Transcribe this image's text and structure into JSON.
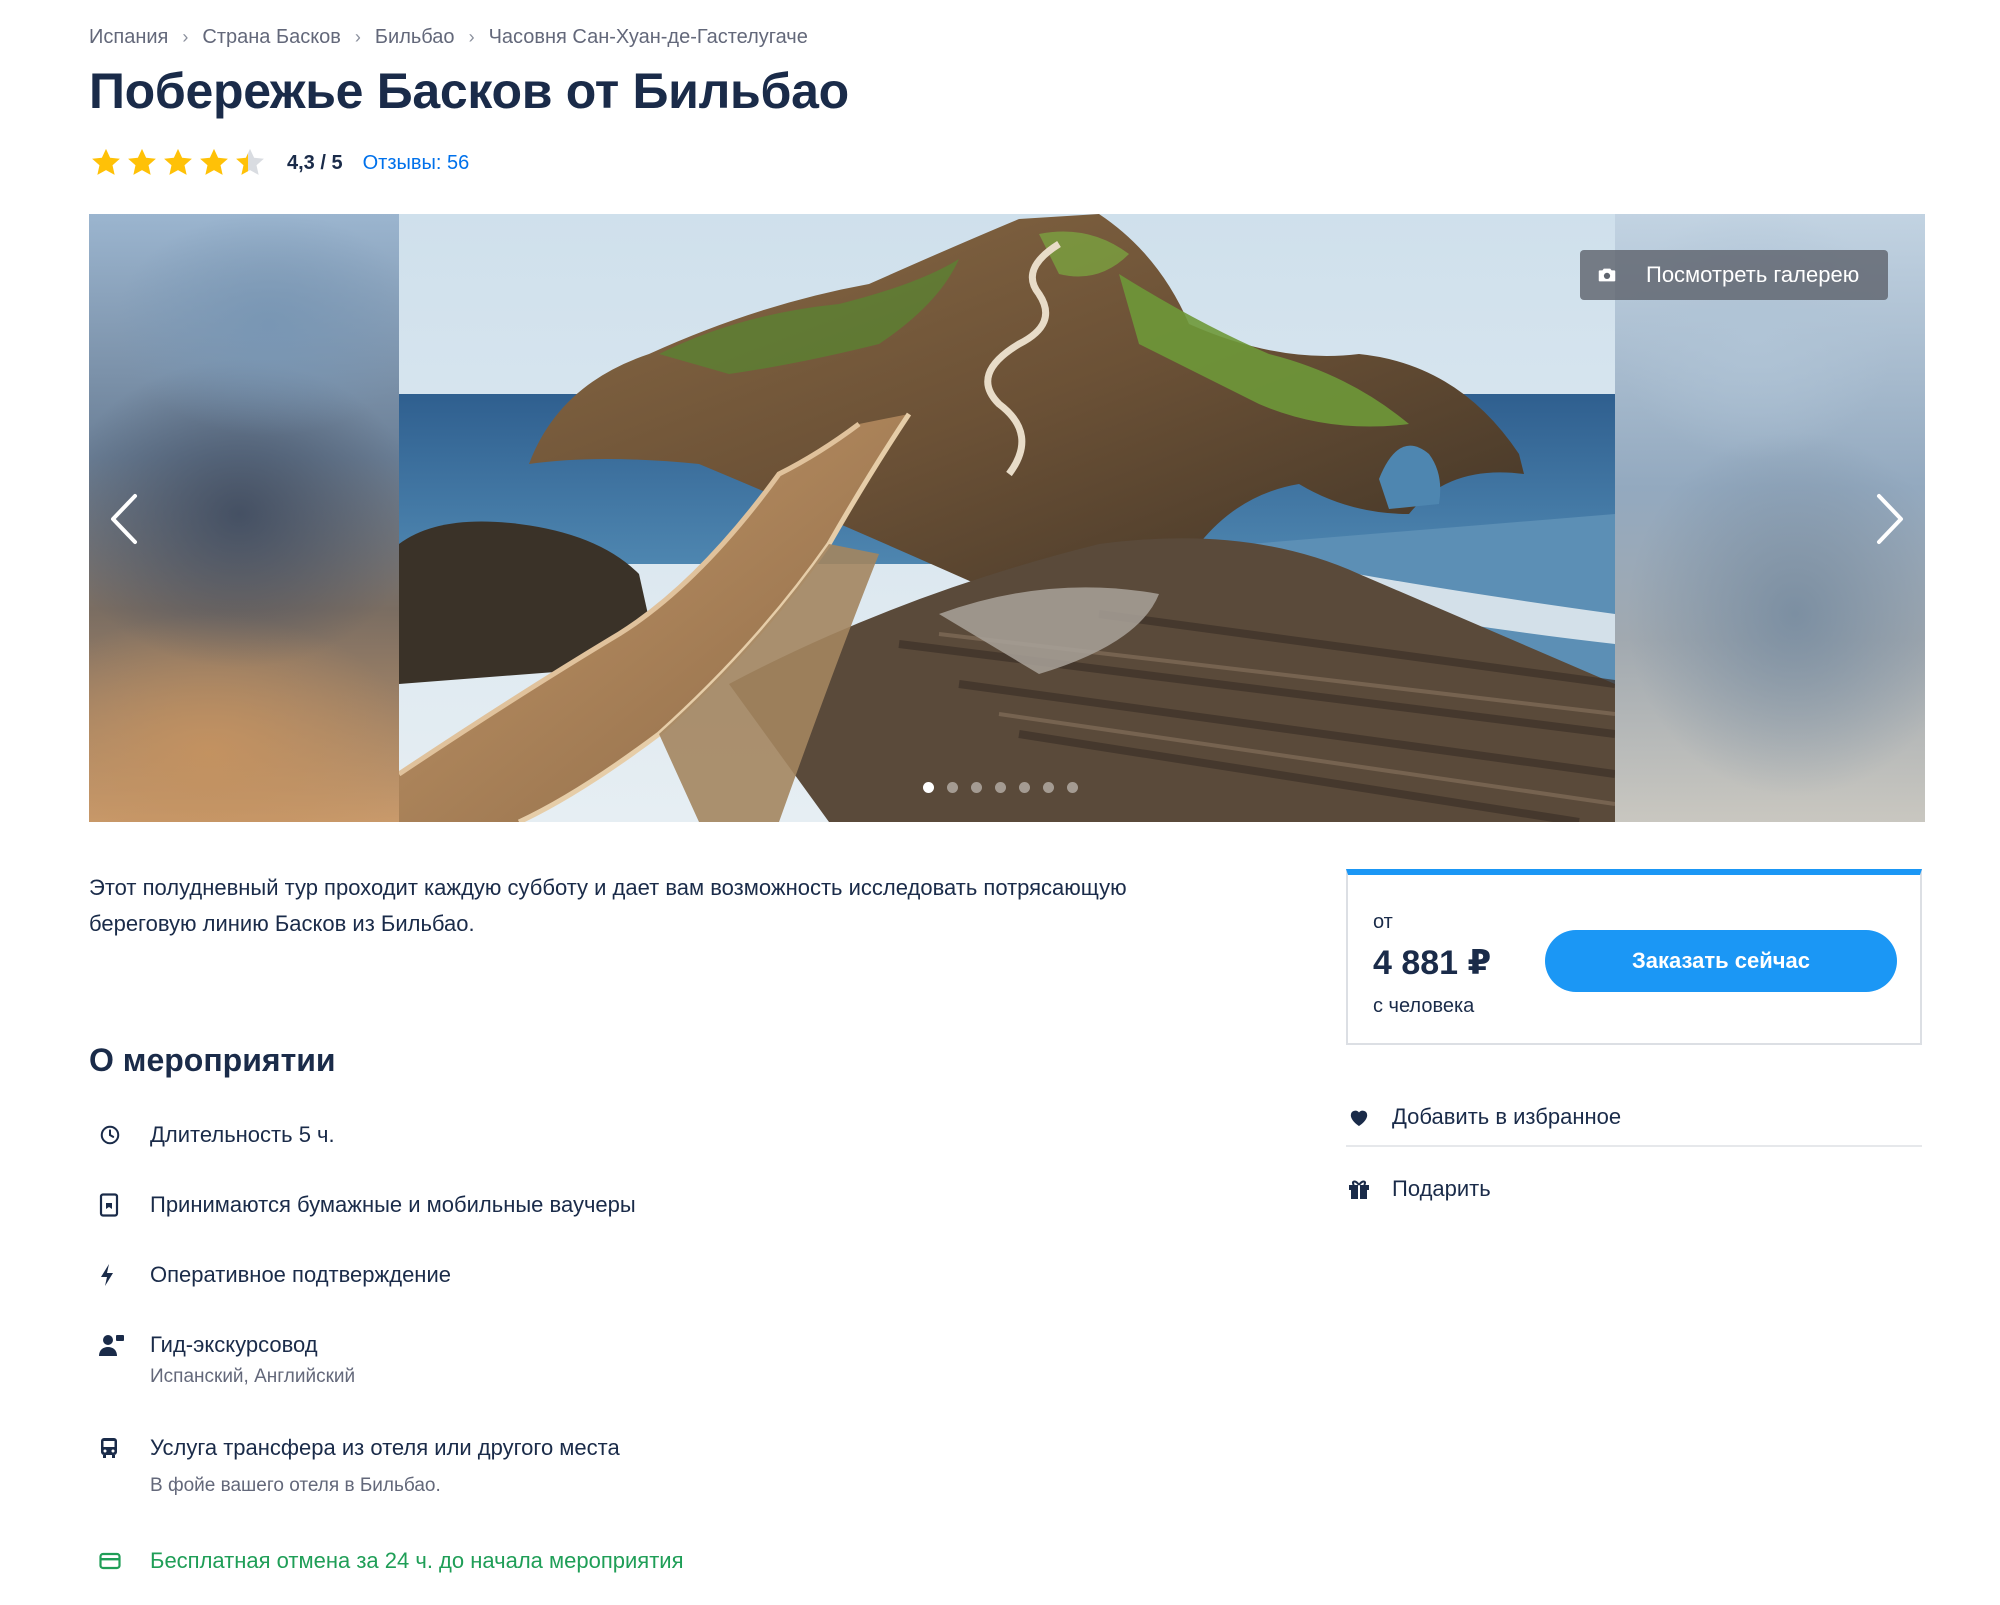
{
  "breadcrumb": [
    "Испания",
    "Страна Басков",
    "Бильбао",
    "Часовня Сан-Хуан-де-Гастелугаче"
  ],
  "breadcrumb_separator": "›",
  "title": "Побережье Басков от Бильбао",
  "rating": {
    "value": 4.3,
    "value_label": "4,3 / 5",
    "max": 5,
    "reviews_label": "Отзывы: 56"
  },
  "gallery": {
    "button_label": "Посмотреть галерею",
    "slides_count": 7,
    "active_slide": 1
  },
  "description": "Этот полудневный тур проходит каждую субботу и дает вам возможность исследовать потрясающую береговую линию Басков из Бильбао.",
  "booking": {
    "from_label": "от",
    "price": "4 881 ₽",
    "per_person": "с человека",
    "button_label": "Заказать сейчас"
  },
  "actions": {
    "favorite": "Добавить в избранное",
    "gift": "Подарить"
  },
  "about": {
    "title": "О мероприятии",
    "features": [
      {
        "icon": "clock-icon",
        "text": "Длительность 5 ч."
      },
      {
        "icon": "voucher-icon",
        "text": "Принимаются бумажные и мобильные ваучеры"
      },
      {
        "icon": "lightning-icon",
        "text": "Оперативное подтверждение"
      },
      {
        "icon": "guide-icon",
        "text": "Гид-экскурсовод",
        "sub": "Испанский, Английский"
      },
      {
        "icon": "bus-icon",
        "text": "Услуга трансфера из отеля или другого места",
        "sub": "В фойе вашего отеля в Бильбао."
      },
      {
        "icon": "card-icon",
        "text": "Бесплатная отмена за 24 ч. до начала мероприятия"
      }
    ]
  },
  "colors": {
    "primary": "#1b97f5",
    "link": "#0071eb",
    "text": "#1a2b49",
    "muted": "#63687a",
    "star": "#ffc107",
    "success": "#1f9e57"
  }
}
